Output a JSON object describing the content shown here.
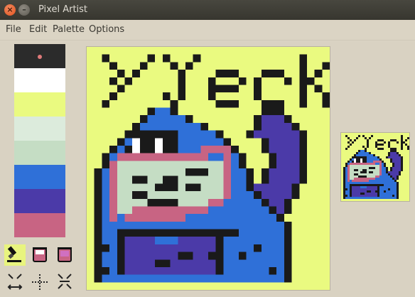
{
  "window": {
    "title": "Pixel Artist"
  },
  "menu": {
    "file": "File",
    "edit": "Edit",
    "palette": "Palette",
    "options": "Options"
  },
  "palette": {
    "selected_index": 0,
    "colors": [
      "#2b2b2b",
      "#ffffff",
      "#eafa80",
      "#dcebdc",
      "#c5ddc4",
      "#2f70d8",
      "#4b3aa8",
      "#c86483"
    ]
  },
  "tools": [
    {
      "icon": "pencil-icon",
      "selected": true
    },
    {
      "icon": "fill-bucket-icon",
      "selected": false
    },
    {
      "icon": "fill-bucket-color-icon",
      "selected": false
    },
    {
      "icon": "flip-horizontal-icon",
      "selected": false
    },
    {
      "icon": "rotate-icon",
      "selected": false
    },
    {
      "icon": "flip-vertical-icon",
      "selected": false
    }
  ],
  "artwork": {
    "title_text": "yeck",
    "background": "#eafa80",
    "outline": "#1a1a1a",
    "body": "#2f70d8",
    "arm": "#4b3aa8",
    "lips": "#c86483",
    "mouth": "#c5ddc4",
    "eyes": "#ffffff"
  }
}
